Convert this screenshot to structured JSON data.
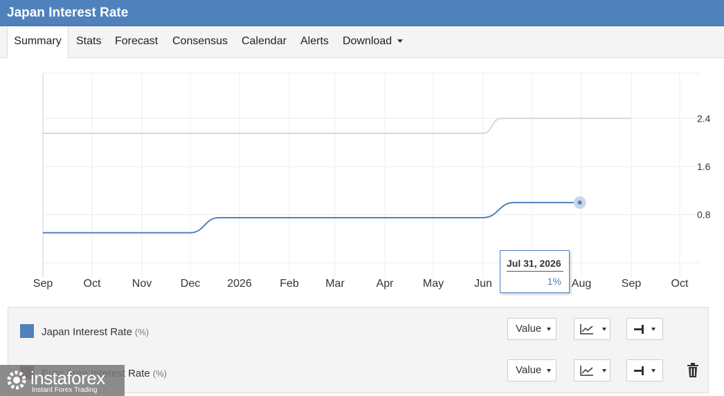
{
  "title": "Japan Interest Rate",
  "tabs": [
    "Summary",
    "Stats",
    "Forecast",
    "Consensus",
    "Calendar",
    "Alerts",
    "Download"
  ],
  "active_tab": "Summary",
  "tooltip": {
    "date": "Jul 31, 2026",
    "value": "1%"
  },
  "legend": [
    {
      "name": "Japan Interest Rate",
      "unit": "(%)",
      "color": "#4f81bd",
      "value_btn": "Value"
    },
    {
      "name": "Euro Area Interest Rate",
      "unit": "(%)",
      "color": "#7f5a5a",
      "value_btn": "Value"
    }
  ],
  "watermark": {
    "name": "instaforex",
    "tagline": "Instant Forex Trading"
  },
  "chart_data": {
    "type": "line",
    "x_labels": [
      "Sep",
      "Oct",
      "Nov",
      "Dec",
      "2026",
      "Feb",
      "Mar",
      "Apr",
      "May",
      "Jun",
      "Jul",
      "Aug",
      "Sep",
      "Oct"
    ],
    "y_ticks": [
      "0.8",
      "1.6",
      "2.4"
    ],
    "ylim": [
      -0.25,
      3.15
    ],
    "grid": true,
    "series": [
      {
        "name": "Japan Interest Rate",
        "color": "#4f81bd",
        "points": [
          [
            "2025-09-01",
            0.5
          ],
          [
            "2025-12-01",
            0.5
          ],
          [
            "2025-12-19",
            0.75
          ],
          [
            "2026-06-01",
            0.75
          ],
          [
            "2026-06-20",
            1.0
          ],
          [
            "2026-07-31",
            1.0
          ]
        ]
      },
      {
        "name": "Euro Area Interest Rate",
        "color": "#e3d3d3",
        "points": [
          [
            "2025-09-01",
            2.15
          ],
          [
            "2026-06-01",
            2.15
          ],
          [
            "2026-06-12",
            2.4
          ],
          [
            "2026-09-01",
            2.4
          ]
        ]
      }
    ],
    "highlight": {
      "series": "Japan Interest Rate",
      "date": "2026-07-31",
      "value": 1.0
    }
  }
}
